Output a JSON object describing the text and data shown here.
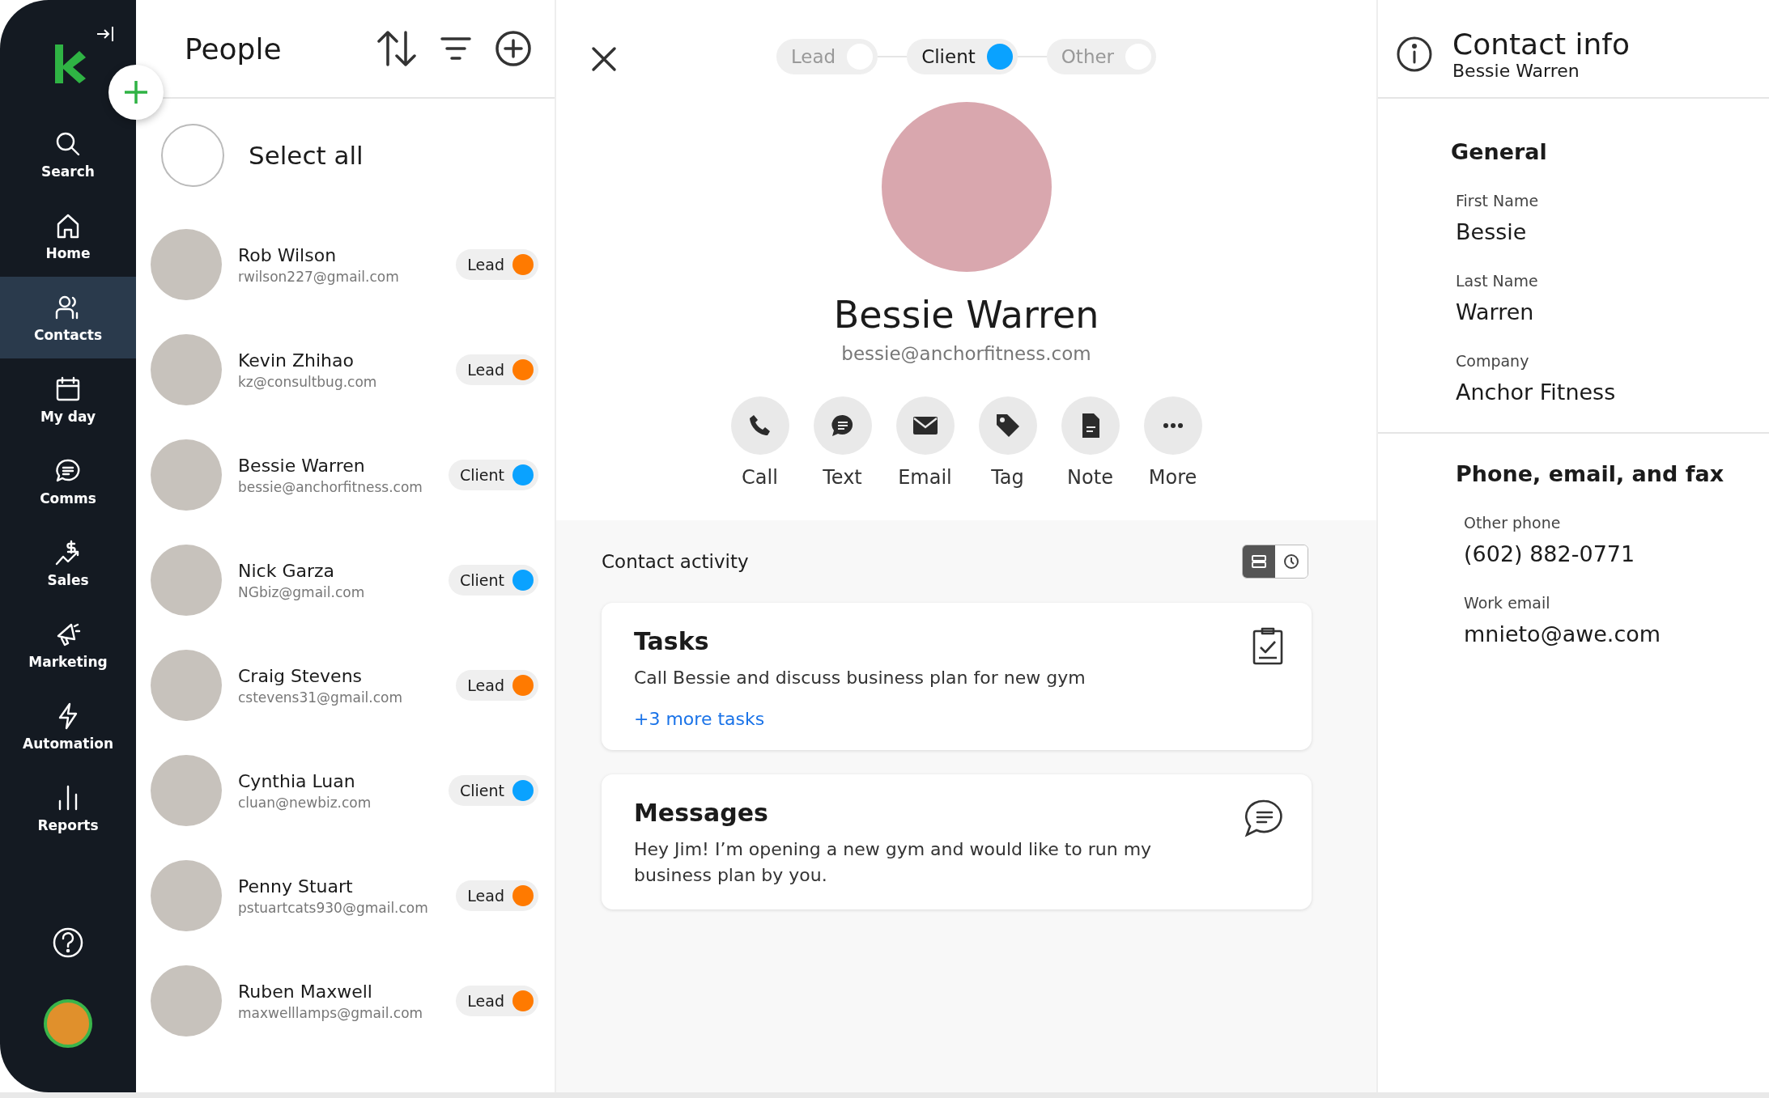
{
  "sidebar": {
    "items": [
      {
        "label": "Search",
        "selected": false
      },
      {
        "label": "Home",
        "selected": false
      },
      {
        "label": "Contacts",
        "selected": true
      },
      {
        "label": "My day",
        "selected": false
      },
      {
        "label": "Comms",
        "selected": false
      },
      {
        "label": "Sales",
        "selected": false
      },
      {
        "label": "Marketing",
        "selected": false
      },
      {
        "label": "Automation",
        "selected": false
      },
      {
        "label": "Reports",
        "selected": false
      }
    ]
  },
  "people": {
    "title": "People",
    "select_all": {
      "label": "Select all",
      "checked": false
    },
    "contacts": [
      {
        "name": "Rob Wilson",
        "email": "rwilson227@gmail.com",
        "tag": "Lead",
        "color": "#ff7a00"
      },
      {
        "name": "Kevin Zhihao",
        "email": "kz@consultbug.com",
        "tag": "Lead",
        "color": "#ff7a00"
      },
      {
        "name": "Bessie Warren",
        "email": "bessie@anchorfitness.com",
        "tag": "Client",
        "color": "#0aa2ff"
      },
      {
        "name": "Nick Garza",
        "email": "NGbiz@gmail.com",
        "tag": "Client",
        "color": "#0aa2ff"
      },
      {
        "name": "Craig Stevens",
        "email": "cstevens31@gmail.com",
        "tag": "Lead",
        "color": "#ff7a00"
      },
      {
        "name": "Cynthia Luan",
        "email": "cluan@newbiz.com",
        "tag": "Client",
        "color": "#0aa2ff"
      },
      {
        "name": "Penny Stuart",
        "email": "pstuartcats930@gmail.com",
        "tag": "Lead",
        "color": "#ff7a00"
      },
      {
        "name": "Ruben Maxwell",
        "email": "maxwelllamps@gmail.com",
        "tag": "Lead",
        "color": "#ff7a00"
      }
    ]
  },
  "detail": {
    "stages": [
      {
        "label": "Lead",
        "selected": false
      },
      {
        "label": "Client",
        "selected": true
      },
      {
        "label": "Other",
        "selected": false
      }
    ],
    "name": "Bessie Warren",
    "email": "bessie@anchorfitness.com",
    "actions": [
      "Call",
      "Text",
      "Email",
      "Tag",
      "Note",
      "More"
    ],
    "activity": {
      "title": "Contact activity",
      "view_toggle": [
        {
          "selected": true
        },
        {
          "selected": false
        }
      ],
      "cards": [
        {
          "kind": "tasks",
          "title": "Tasks",
          "text": "Call Bessie and discuss business plan for new gym",
          "link": "+3 more tasks"
        },
        {
          "kind": "messages",
          "title": "Messages",
          "text": "Hey Jim! I’m opening a new gym and would like to run my business plan by you."
        }
      ]
    }
  },
  "contact_info": {
    "title": "Contact info",
    "subtitle": "Bessie Warren",
    "sections": [
      {
        "title": "General",
        "fields": [
          {
            "label": "First Name",
            "value": "Bessie"
          },
          {
            "label": "Last Name",
            "value": "Warren"
          },
          {
            "label": "Company",
            "value": "Anchor Fitness"
          }
        ]
      },
      {
        "title": "Phone, email, and fax",
        "fields": [
          {
            "label": "Other phone",
            "value": "(602) 882-0771"
          },
          {
            "label": "Work email",
            "value": "mnieto@awe.com"
          }
        ]
      }
    ]
  }
}
